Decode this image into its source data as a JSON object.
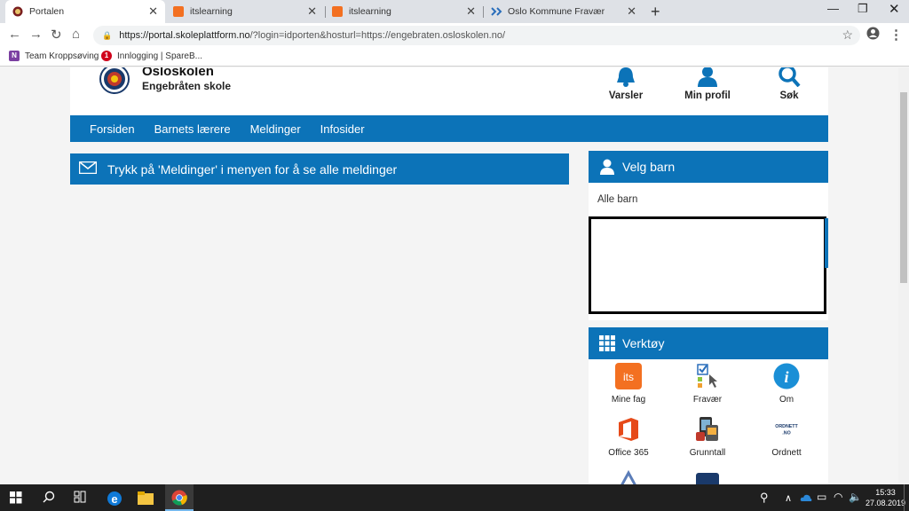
{
  "browser": {
    "tabs": [
      {
        "title": "Portalen",
        "favicon_color": "#ffffff",
        "active": true
      },
      {
        "title": "itslearning",
        "favicon_color": "#f37021",
        "active": false
      },
      {
        "title": "itslearning",
        "favicon_color": "#f37021",
        "active": false
      },
      {
        "title": "Oslo Kommune Fravær",
        "favicon_color": "#2a6ebb",
        "active": false
      }
    ],
    "new_tab_icon": "plus-icon",
    "url_host": "https://portal.skoleplattform.no",
    "url_path": "/?login=idporten&hosturl=https://engebraten.osloskolen.no/",
    "bookmarks": [
      {
        "label": "Team Kroppsøving",
        "icon_color": "#7b3fa1",
        "icon_text": "N"
      },
      {
        "label": "Innlogging | SpareB...",
        "icon_color": "#d0021b",
        "icon_text": "1"
      }
    ]
  },
  "site": {
    "brand": "Osloskolen",
    "school": "Engebråten skole",
    "header_items": [
      {
        "label": "Varsler",
        "icon": "bell-icon"
      },
      {
        "label": "Min profil",
        "icon": "user-icon"
      },
      {
        "label": "Søk",
        "icon": "search-icon"
      }
    ],
    "nav": [
      "Forsiden",
      "Barnets lærere",
      "Meldinger",
      "Infosider"
    ],
    "message_banner": "Trykk på 'Meldinger' i menyen for å se alle meldinger",
    "velg_barn": {
      "title": "Velg barn",
      "all_children": "Alle barn"
    },
    "verktoy": {
      "title": "Verktøy",
      "tools": [
        {
          "label": "Mine fag",
          "icon": "itslearning-icon"
        },
        {
          "label": "Fravær",
          "icon": "absence-icon"
        },
        {
          "label": "Om",
          "icon": "info-icon"
        },
        {
          "label": "Office 365",
          "icon": "office-icon"
        },
        {
          "label": "Grunntall",
          "icon": "grunntall-icon"
        },
        {
          "label": "Ordnett",
          "icon": "ordnett-icon"
        }
      ]
    },
    "accent_color": "#0c73b8"
  },
  "taskbar": {
    "time": "15:33",
    "date": "27.08.2019"
  }
}
